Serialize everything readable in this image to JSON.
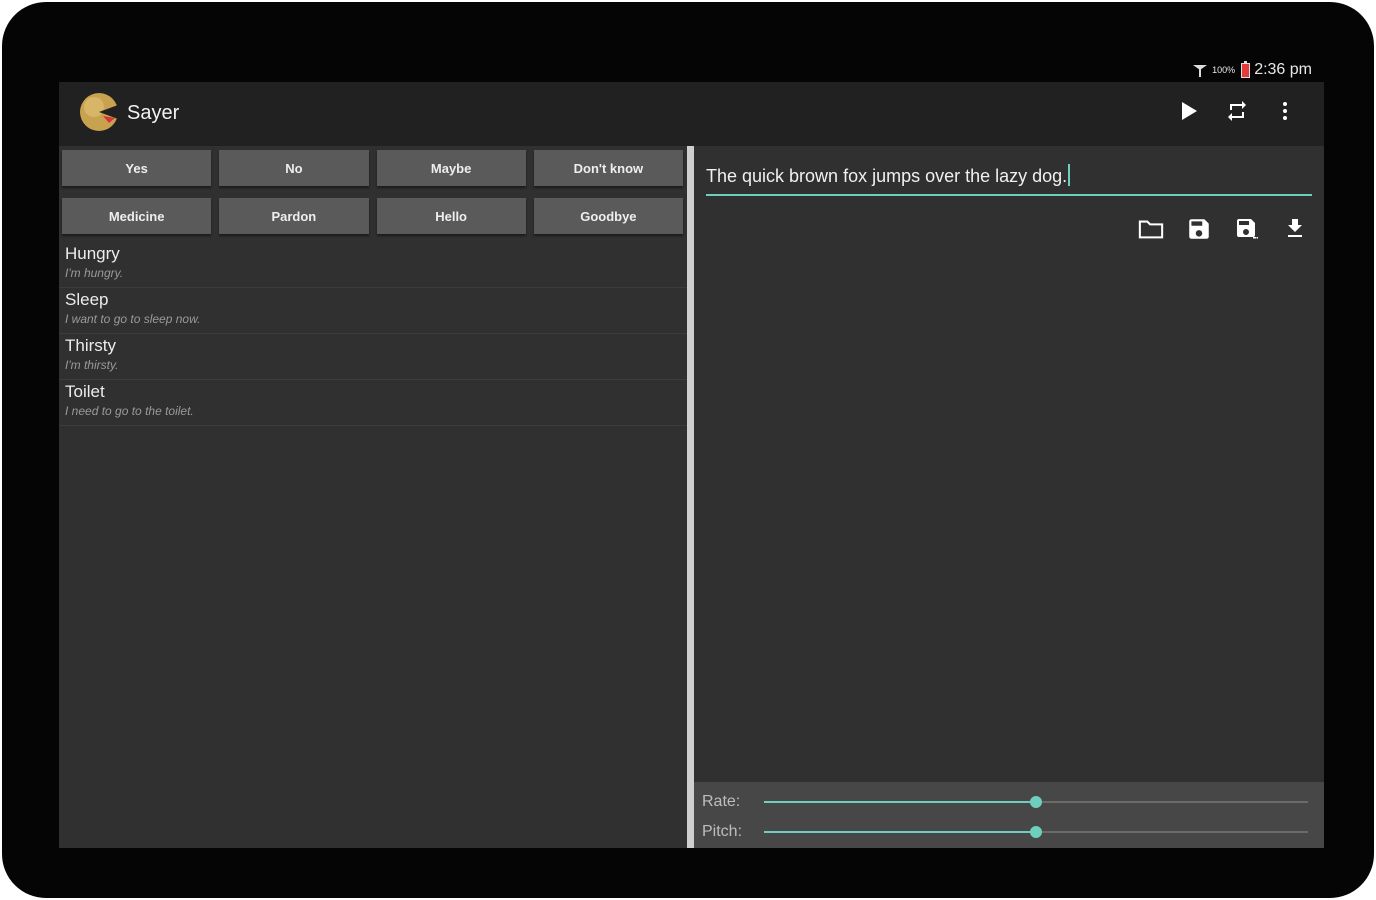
{
  "status": {
    "battery_pct": "100%",
    "time": "2:36 pm"
  },
  "app": {
    "title": "Sayer"
  },
  "quick_buttons": [
    {
      "label": "Yes"
    },
    {
      "label": "No"
    },
    {
      "label": "Maybe"
    },
    {
      "label": "Don't know"
    },
    {
      "label": "Medicine"
    },
    {
      "label": "Pardon"
    },
    {
      "label": "Hello"
    },
    {
      "label": "Goodbye"
    }
  ],
  "phrases": [
    {
      "title": "Hungry",
      "text": "I'm hungry."
    },
    {
      "title": "Sleep",
      "text": "I want to go to sleep now."
    },
    {
      "title": "Thirsty",
      "text": "I'm thirsty."
    },
    {
      "title": "Toilet",
      "text": "I need to go to the toilet."
    }
  ],
  "editor": {
    "text": "The quick brown fox jumps over the lazy dog."
  },
  "sliders": {
    "rate": {
      "label": "Rate:",
      "value": 0.5
    },
    "pitch": {
      "label": "Pitch:",
      "value": 0.5
    }
  },
  "colors": {
    "accent": "#6fcfbf",
    "appbar": "#212121",
    "background": "#303030"
  },
  "icons": {
    "play": "play-icon",
    "repeat": "repeat-icon",
    "more": "more-vert-icon",
    "open": "folder-icon",
    "save": "save-icon",
    "save_as": "save-as-icon",
    "download": "download-icon"
  }
}
